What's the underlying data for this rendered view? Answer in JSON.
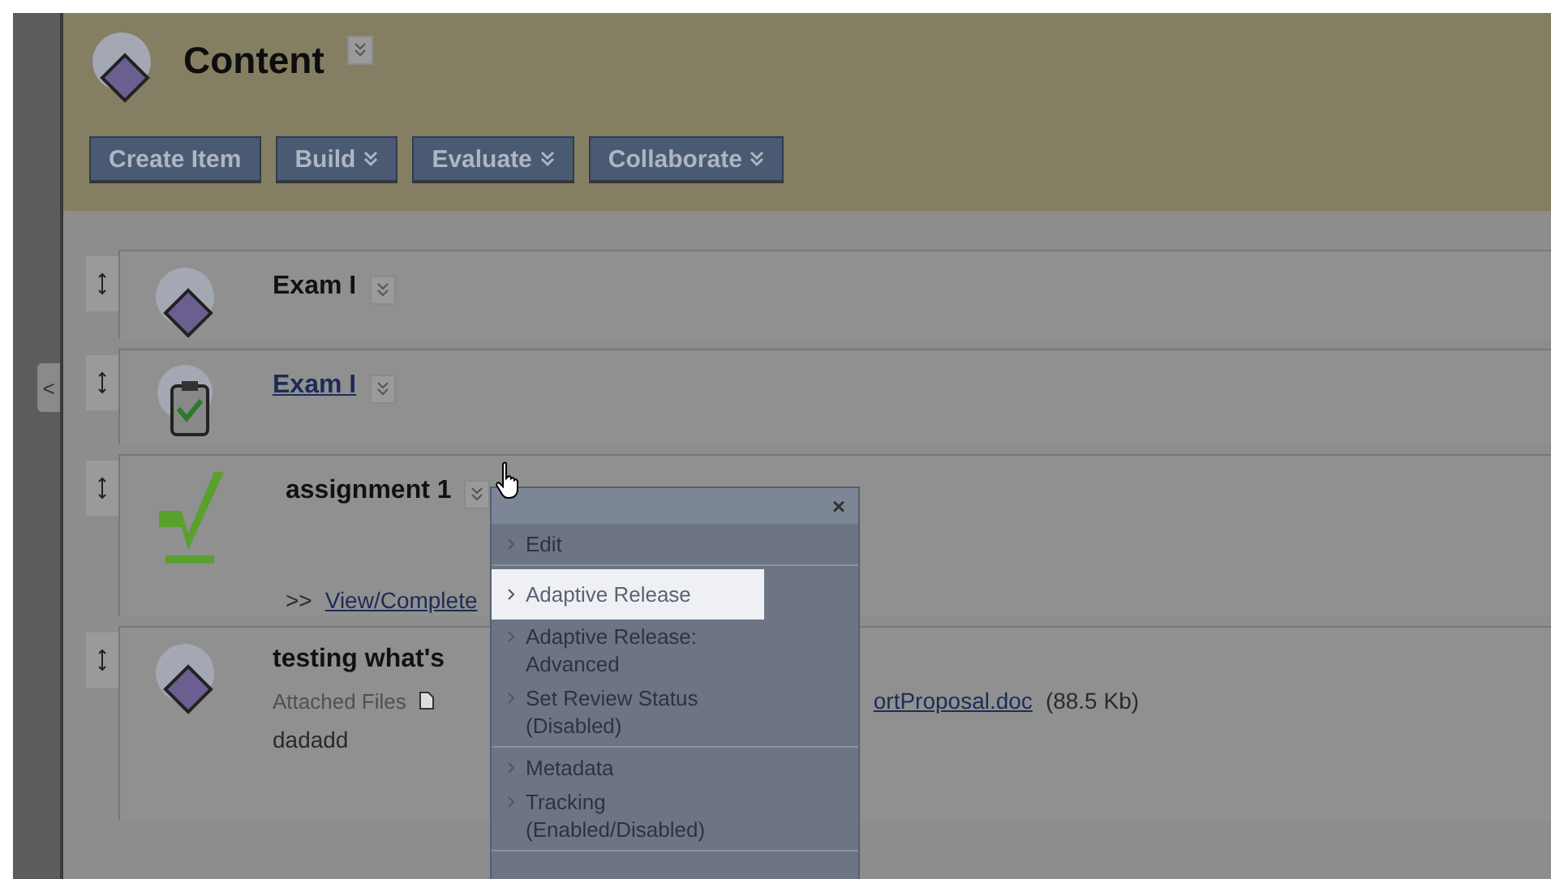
{
  "page": {
    "title": "Content",
    "side_tab": "<"
  },
  "toolbar": [
    {
      "label": "Create Item",
      "has_menu": false
    },
    {
      "label": "Build",
      "has_menu": true
    },
    {
      "label": "Evaluate",
      "has_menu": true
    },
    {
      "label": "Collaborate",
      "has_menu": true
    }
  ],
  "items": [
    {
      "kind": "document",
      "title": "Exam I",
      "link": false
    },
    {
      "kind": "test",
      "title": "Exam I",
      "link": true
    },
    {
      "kind": "assignment",
      "title": "assignment 1",
      "link": false,
      "action_prefix": ">>",
      "action_link": "View/Complete"
    },
    {
      "kind": "document",
      "title": "testing what's",
      "link": false,
      "attached_label": "Attached Files",
      "attached_file": "ortProposal.doc",
      "attached_size": "(88.5 Kb)",
      "body": "dadadd"
    }
  ],
  "menu": {
    "close": "×",
    "groups": [
      [
        {
          "label": "Edit",
          "highlighted": false
        }
      ],
      [
        {
          "label": "Adaptive Release",
          "highlighted": true
        },
        {
          "label": "Adaptive Release: Advanced",
          "highlighted": false
        },
        {
          "label": "Set Review Status (Disabled)",
          "highlighted": false
        }
      ],
      [
        {
          "label": "Metadata",
          "highlighted": false
        },
        {
          "label": "Tracking (Enabled/Disabled)",
          "highlighted": false
        }
      ]
    ]
  }
}
